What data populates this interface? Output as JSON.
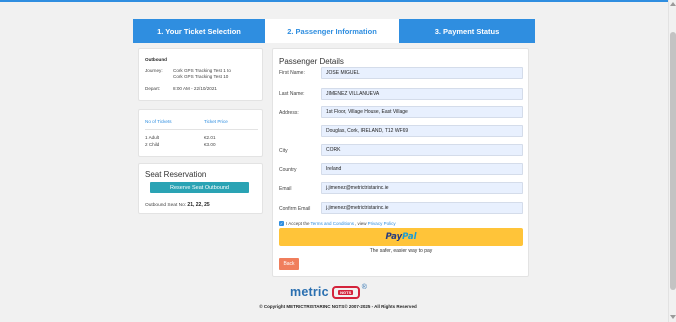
{
  "tabs": [
    {
      "label": "1. Your Ticket Selection"
    },
    {
      "label": "2. Passenger Information"
    },
    {
      "label": "3. Payment Status"
    }
  ],
  "journey": {
    "title": "Outbound",
    "journey_label": "Journey:",
    "journey_value_1": "Cork GPS Tracking Test 1 to",
    "journey_value_2": "Cork GPS Tracking Test 10",
    "depart_label": "Depart:",
    "depart_value": "8:00 AM - 22/10/2021"
  },
  "tickets": {
    "col_count": "No of Tickets",
    "col_price": "Ticket Price",
    "rows": [
      {
        "count": "1 Adult",
        "price": "€2.01"
      },
      {
        "count": "2 Child",
        "price": "€3.00"
      }
    ]
  },
  "seat": {
    "title": "Seat Reservation",
    "button": "Reserve Seat Outbound",
    "seat_label": "Outbound Seat No:",
    "seat_value": "21, 22, 25"
  },
  "passenger": {
    "title": "Passenger Details",
    "fields": [
      {
        "label": "First Name:",
        "value": "JOSE MIGUEL"
      },
      {
        "label": "Last Name:",
        "value": "JIMENEZ VILLANUEVA"
      },
      {
        "label": "Address:",
        "value": "1st Floor, Village House, East Village"
      },
      {
        "label": "",
        "value": "Douglas, Cork, IRELAND, T12 WF69"
      },
      {
        "label": "City",
        "value": "CORK"
      },
      {
        "label": "Country",
        "value": "Ireland"
      },
      {
        "label": "Email",
        "value": "j.jimenez@metrictristarinc.ie"
      },
      {
        "label": "Confirm Email",
        "value": "j.jimenez@metrictristarinc.ie"
      }
    ],
    "accept_prefix": "I Accept the",
    "terms_link": "Terms and Conditions",
    "accept_mid": ", view",
    "privacy_link": "Privacy Policy",
    "paypal_pay": "Pay",
    "paypal_pal": "Pal",
    "paypal_tagline": "The safer, easier way to pay",
    "back_button": "Back"
  },
  "footer": {
    "logo_text": "metric",
    "logo_badge": "NGTS",
    "logo_reg": "®",
    "copyright": "© Copyright METRICTRISTARINC NGTS© 2007-2025 - All Rights Reserved"
  },
  "colors": {
    "accent": "#2f8ee0",
    "seat_button": "#2aa3b4",
    "paypal_yellow": "#ffc439",
    "back_button": "#f07e5c",
    "logo_red": "#d4233b"
  }
}
